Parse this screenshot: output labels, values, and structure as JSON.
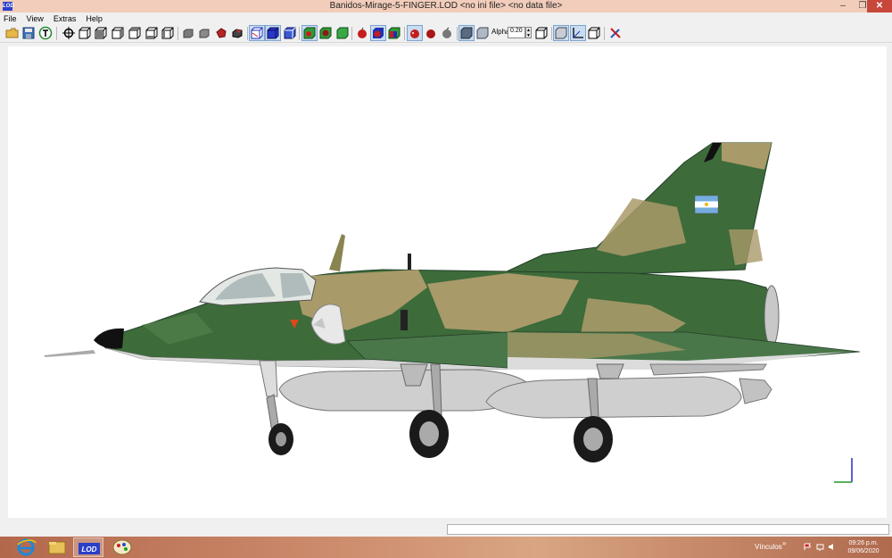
{
  "window": {
    "title": "Banidos-Mirage-5-FINGER.LOD  <no ini file>  <no data file>",
    "app_icon_label": "LOD",
    "controls": {
      "minimize": "–",
      "maximize": "❐",
      "close": "✕"
    }
  },
  "menu": {
    "items": [
      {
        "label": "File"
      },
      {
        "label": "View"
      },
      {
        "label": "Extras"
      },
      {
        "label": "Help"
      }
    ]
  },
  "toolbar": {
    "alpha_label": "Alpha:",
    "alpha_value": "0.20",
    "spin_up": "▲",
    "spin_down": "▼"
  },
  "taskbar": {
    "tray_label": "Vínculos",
    "tray_chevron": "»",
    "clock_time": "09:26 p.m.",
    "clock_date": "09/06/2020"
  },
  "colors": {
    "camo_green": "#3d6b3a",
    "camo_tan": "#a99a6a",
    "belly_grey": "#d8d8d8",
    "highlight": "#c9dcf0"
  },
  "icons": [
    "open-folder-icon",
    "save-disk-icon",
    "text-t-icon",
    "zoom-crosshair-icon",
    "cube-view-icons",
    "grey-block-icons",
    "red-block-icon",
    "wire-cube-icons",
    "render-cube-icons",
    "red-apple-icons",
    "alpha-cube-icons",
    "axes-icon",
    "tools-icon"
  ]
}
